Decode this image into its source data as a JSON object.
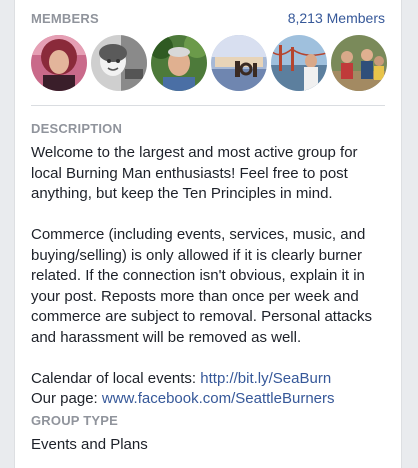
{
  "members": {
    "title": "MEMBERS",
    "count": "8,213 Members",
    "avatars": [
      {
        "name": "member-avatar-1"
      },
      {
        "name": "member-avatar-2"
      },
      {
        "name": "member-avatar-3"
      },
      {
        "name": "member-avatar-4"
      },
      {
        "name": "member-avatar-5"
      },
      {
        "name": "member-avatar-6"
      }
    ]
  },
  "description": {
    "title": "DESCRIPTION",
    "para1": "Welcome to the largest and most active group for local Burning Man enthusiasts! Feel free to post anything, but keep the Ten Principles in mind.",
    "para2": "Commerce (including events, services, music, and buying/selling) is only allowed if it is clearly burner related. If the connection isn't obvious, explain it in your post. Reposts more than once per week and commerce are subject to removal. Personal attacks and harassment will be removed as well.",
    "calendar_label": "Calendar of local events: ",
    "calendar_link": "http://bit.ly/SeaBurn",
    "page_label": "Our page: ",
    "page_link": "www.facebook.com/SeattleBurners"
  },
  "group_type": {
    "title": "GROUP TYPE",
    "value": "Events and Plans"
  },
  "colors": {
    "link": "#365899",
    "section_title": "#90949c",
    "body_text": "#1d2129",
    "page_bg": "#e9ebee"
  }
}
